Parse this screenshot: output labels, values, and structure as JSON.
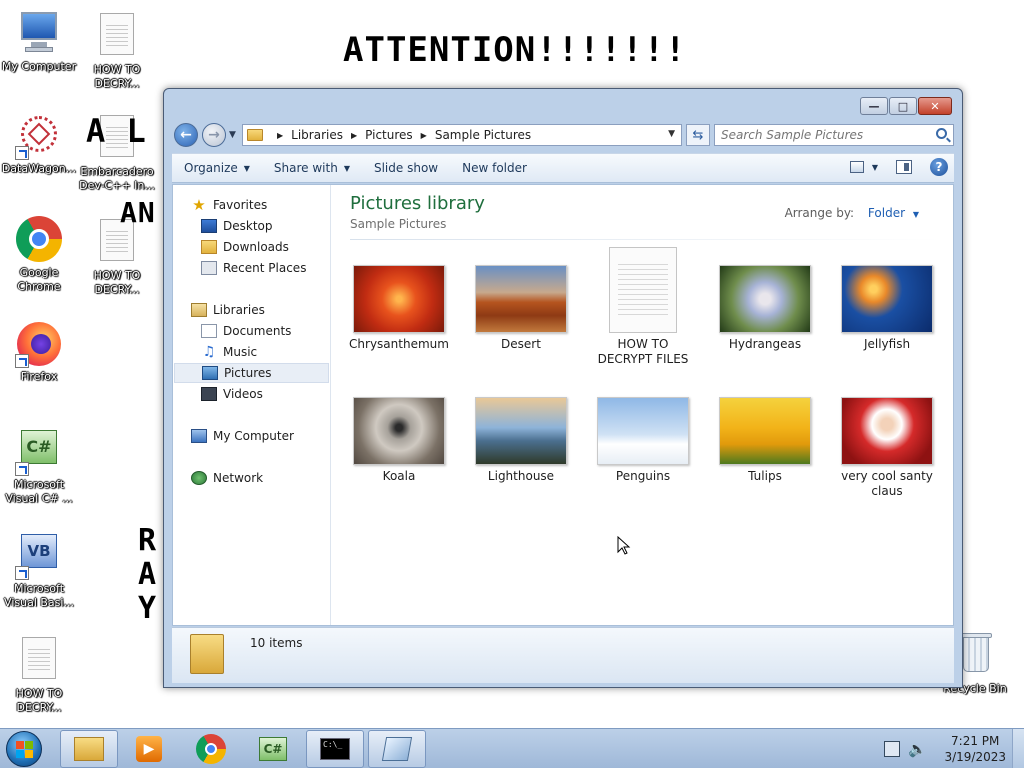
{
  "desktop": {
    "icons": [
      {
        "label": "My Computer"
      },
      {
        "label": "HOW TO\nDECRY..."
      },
      {
        "label": "DataWagon..."
      },
      {
        "label": "Embarcadero\nDev-C++ In..."
      },
      {
        "label": "Google\nChrome"
      },
      {
        "label": "HOW TO\nDECRY..."
      },
      {
        "label": "Firefox"
      },
      {
        "label": "Microsoft\nVisual C# ..."
      },
      {
        "label": "Microsoft\nVisual Basi..."
      },
      {
        "label": "HOW TO\nDECRY..."
      },
      {
        "label": "Recycle Bin"
      }
    ],
    "ransom_heading": "ATTENTION!!!!!!!"
  },
  "window": {
    "address": {
      "crumbs": [
        "Libraries",
        "Pictures",
        "Sample Pictures"
      ]
    },
    "search": {
      "placeholder": "Search Sample Pictures"
    },
    "toolbar": {
      "organize": "Organize",
      "share_with": "Share with",
      "slide_show": "Slide show",
      "new_folder": "New folder"
    },
    "nav": {
      "favorites": "Favorites",
      "desktop": "Desktop",
      "downloads": "Downloads",
      "recent_places": "Recent Places",
      "libraries": "Libraries",
      "documents": "Documents",
      "music": "Music",
      "pictures": "Pictures",
      "videos": "Videos",
      "my_computer": "My Computer",
      "network": "Network"
    },
    "library": {
      "title": "Pictures library",
      "subtitle": "Sample Pictures",
      "arrange_label": "Arrange by:",
      "arrange_value": "Folder"
    },
    "files": [
      {
        "name": "Chrysanthemum",
        "kind": "image"
      },
      {
        "name": "Desert",
        "kind": "image"
      },
      {
        "name": "HOW TO\nDECRYPT FILES",
        "kind": "document"
      },
      {
        "name": "Hydrangeas",
        "kind": "image"
      },
      {
        "name": "Jellyfish",
        "kind": "image"
      },
      {
        "name": "Koala",
        "kind": "image"
      },
      {
        "name": "Lighthouse",
        "kind": "image"
      },
      {
        "name": "Penguins",
        "kind": "image"
      },
      {
        "name": "Tulips",
        "kind": "image"
      },
      {
        "name": "very cool santy\nclaus",
        "kind": "image"
      }
    ],
    "status": {
      "item_count": "10 items"
    }
  },
  "taskbar": {
    "time": "7:21 PM",
    "date": "3/19/2023"
  },
  "colors": {
    "window_frame": "#bcd0e8",
    "library_title": "#1f6e3d",
    "link_blue": "#1f5fb3"
  }
}
